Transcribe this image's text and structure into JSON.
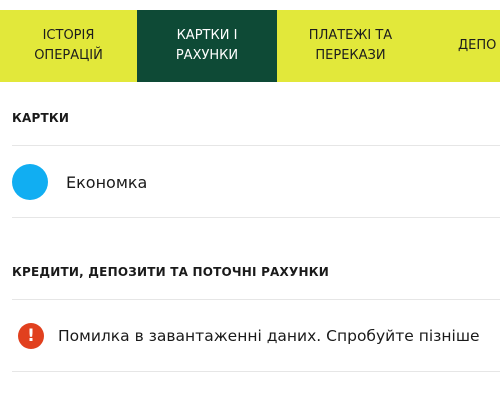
{
  "tabs": [
    {
      "label": "ІСТОРІЯ\nОПЕРАЦІЙ",
      "active": false
    },
    {
      "label": "КАРТКИ І\nРАХУНКИ",
      "active": true
    },
    {
      "label": "ПЛАТЕЖІ ТА\nПЕРЕКАЗИ",
      "active": false
    },
    {
      "label": "ДЕПО",
      "active": false
    }
  ],
  "cards_section": {
    "title": "КАРТКИ",
    "items": [
      {
        "name": "Економка",
        "color": "#11aef2"
      }
    ]
  },
  "accounts_section": {
    "title": "КРЕДИТИ, ДЕПОЗИТИ ТА ПОТОЧНІ РАХУНКИ",
    "error_icon": "!",
    "error_message": "Помилка в завантаженні даних. Спробуйте пізніше"
  },
  "colors": {
    "tab_bar": "#e2e83a",
    "tab_active": "#0e4a36",
    "error": "#e1401e"
  }
}
